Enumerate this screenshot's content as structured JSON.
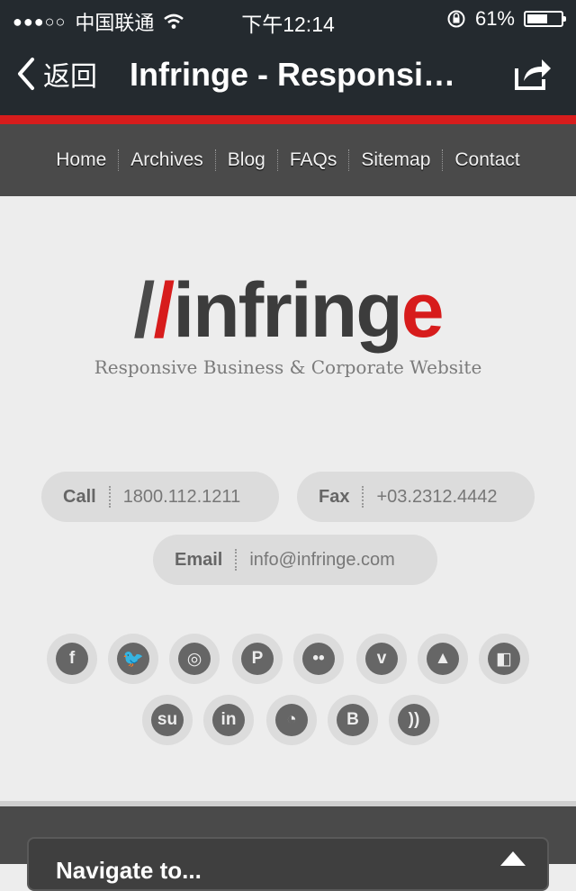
{
  "status": {
    "signal": "●●●○○",
    "carrier": "中国联通",
    "time": "下午12:14",
    "battery": "61%",
    "battery_level": 0.61
  },
  "nav": {
    "back": "返回",
    "title": "Infringe - Responsi…"
  },
  "menu": [
    "Home",
    "Archives",
    "Blog",
    "FAQs",
    "Sitemap",
    "Contact"
  ],
  "logo": {
    "slash1": "/",
    "slash2": "/",
    "word": "infring",
    "e": "e",
    "tagline": "Responsive Business & Corporate Website"
  },
  "contact": {
    "call_label": "Call",
    "call_value": "1800.112.1211",
    "fax_label": "Fax",
    "fax_value": "+03.2312.4442",
    "email_label": "Email",
    "email_value": "info@infringe.com"
  },
  "social": [
    {
      "icon": "facebook-icon",
      "glyph": "f"
    },
    {
      "icon": "twitter-icon",
      "glyph": "🐦"
    },
    {
      "icon": "dribbble-icon",
      "glyph": "◎"
    },
    {
      "icon": "pinterest-icon",
      "glyph": "P"
    },
    {
      "icon": "flickr-icon",
      "glyph": "••"
    },
    {
      "icon": "vimeo-icon",
      "glyph": "v"
    },
    {
      "icon": "forrst-icon",
      "glyph": "▲"
    },
    {
      "icon": "delicious-icon",
      "glyph": "◧"
    },
    {
      "icon": "stumbleupon-icon",
      "glyph": "su"
    },
    {
      "icon": "linkedin-icon",
      "glyph": "in"
    },
    {
      "icon": "picasa-icon",
      "glyph": "◔"
    },
    {
      "icon": "blogger-icon",
      "glyph": "B"
    },
    {
      "icon": "rss-icon",
      "glyph": "))"
    }
  ],
  "widget": {
    "title": "Navigate to..."
  },
  "colors": {
    "accent": "#d71c1c",
    "bar": "#242a2f",
    "menu": "#4a4a4a"
  }
}
